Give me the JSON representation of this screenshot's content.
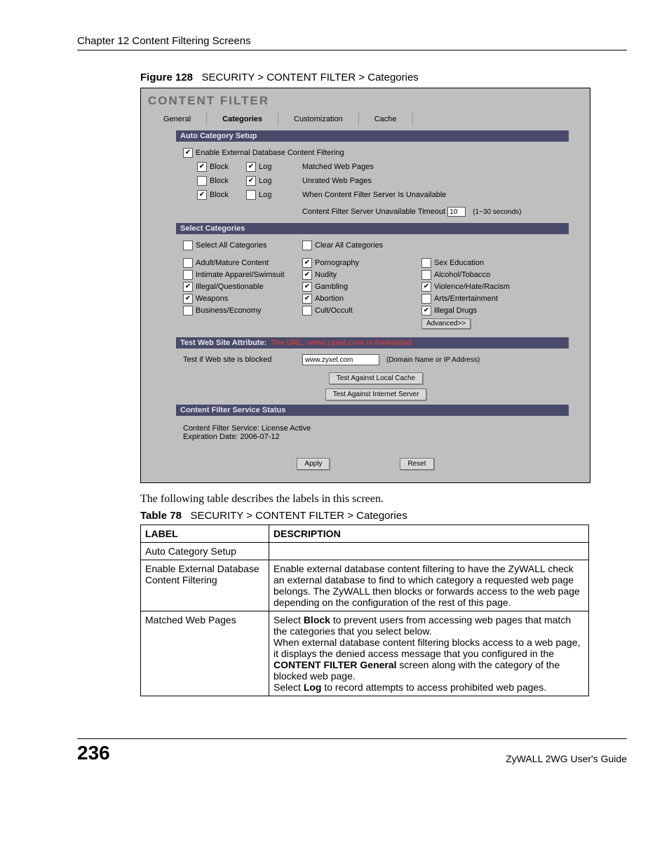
{
  "chapter": "Chapter 12 Content Filtering Screens",
  "figure": {
    "num": "Figure 128",
    "title": "SECURITY > CONTENT FILTER > Categories"
  },
  "cf": {
    "title": "CONTENT FILTER",
    "tabs": [
      "General",
      "Categories",
      "Customization",
      "Cache"
    ],
    "activeTab": 1,
    "autoSetup": {
      "bar": "Auto Category Setup",
      "enableLabel": "Enable External Database Content Filtering",
      "enableChecked": true,
      "rows": [
        {
          "block": true,
          "log": true,
          "label": "Matched Web Pages"
        },
        {
          "block": false,
          "log": true,
          "label": "Unrated Web Pages"
        },
        {
          "block": true,
          "log": false,
          "label": "When Content Filter Server Is Unavailable"
        }
      ],
      "blockWord": "Block",
      "logWord": "Log",
      "timeoutLabel": "Content Filter Server Unavailable Timeout",
      "timeoutValue": "10",
      "timeoutHint": "(1~30 seconds)"
    },
    "selectCats": {
      "bar": "Select Categories",
      "selectAll": "Select All Categories",
      "clearAll": "Clear All Categories",
      "items": [
        {
          "label": "Adult/Mature Content",
          "checked": false
        },
        {
          "label": "Pornography",
          "checked": true
        },
        {
          "label": "Sex Education",
          "checked": false
        },
        {
          "label": "Intimate Apparel/Swimsuit",
          "checked": false
        },
        {
          "label": "Nudity",
          "checked": true
        },
        {
          "label": "Alcohol/Tobacco",
          "checked": false
        },
        {
          "label": "Illegal/Questionable",
          "checked": true
        },
        {
          "label": "Gambling",
          "checked": true
        },
        {
          "label": "Violence/Hate/Racism",
          "checked": true
        },
        {
          "label": "Weapons",
          "checked": true
        },
        {
          "label": "Abortion",
          "checked": true
        },
        {
          "label": "Arts/Entertainment",
          "checked": false
        },
        {
          "label": "Business/Economy",
          "checked": false
        },
        {
          "label": "Cult/Occult",
          "checked": false
        },
        {
          "label": "Illegal Drugs",
          "checked": true
        }
      ],
      "advanced": "Advanced>>"
    },
    "test": {
      "barLabel": "Test Web Site Attribute:",
      "barMsg": "The URL: www.zyxel.com is forwarded",
      "testIf": "Test if Web site is blocked",
      "url": "www.zyxel.com",
      "urlHint": "(Domain Name or IP Address)",
      "btnLocal": "Test Against Local Cache",
      "btnInternet": "Test Against Internet Server"
    },
    "status": {
      "bar": "Content Filter Service Status",
      "line1": "Content Filter Service: License Active",
      "line2": "Expiration Date: 2006-07-12"
    },
    "apply": "Apply",
    "reset": "Reset"
  },
  "introText": "The following table describes the labels in this screen.",
  "table": {
    "num": "Table 78",
    "title": "SECURITY > CONTENT FILTER > Categories",
    "headLabel": "LABEL",
    "headDesc": "DESCRIPTION",
    "rows": [
      {
        "label": "Auto Category Setup",
        "desc": ""
      },
      {
        "label": "Enable External Database Content Filtering",
        "desc": "Enable external database content filtering to have the ZyWALL check an external database to find to which category a requested web page belongs. The ZyWALL then blocks or forwards access to the web page depending on the configuration of the rest of this page."
      },
      {
        "label": "Matched Web Pages",
        "desc_parts": {
          "p1a": "Select ",
          "p1b": "Block",
          "p1c": " to prevent users from accessing web pages that match the categories that you select below.",
          "p2a": "When external database content filtering blocks access to a web page, it displays the denied access message that you configured in the ",
          "p2b": "CONTENT FILTER General",
          "p2c": " screen along with the category of the blocked web page.",
          "p3a": "Select ",
          "p3b": "Log",
          "p3c": " to record attempts to access prohibited web pages."
        }
      }
    ]
  },
  "pageNumber": "236",
  "guide": "ZyWALL 2WG User's Guide"
}
